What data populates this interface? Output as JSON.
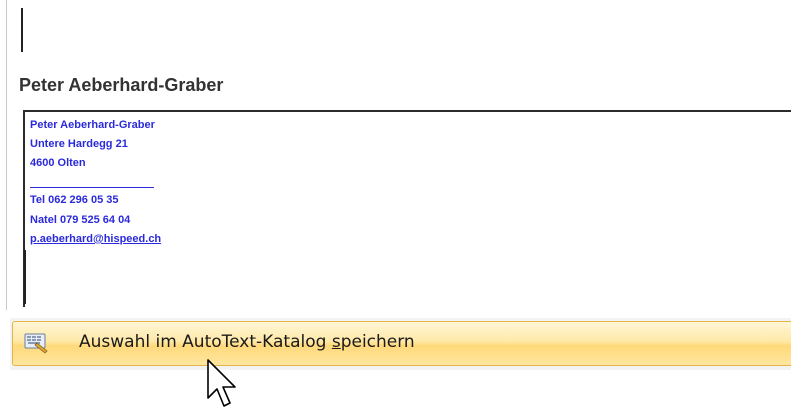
{
  "gallery": {
    "entry_title": "Peter Aeberhard-Graber",
    "preview": {
      "lines": [
        "Peter Aeberhard-Graber",
        "Untere Hardegg 21",
        "4600 Olten",
        "Tel 062 296 05 35",
        "Natel 079 525 64 04",
        "p.aeberhard@hispeed.ch"
      ],
      "text_color": "#2a2adc"
    }
  },
  "menu": {
    "save_selection": {
      "label_before": "Auswahl im AutoText-Katalog ",
      "label_accel": "s",
      "label_after": "peichern",
      "icon": "autotext-save-icon",
      "highlight_color": "#ffd97a"
    }
  }
}
